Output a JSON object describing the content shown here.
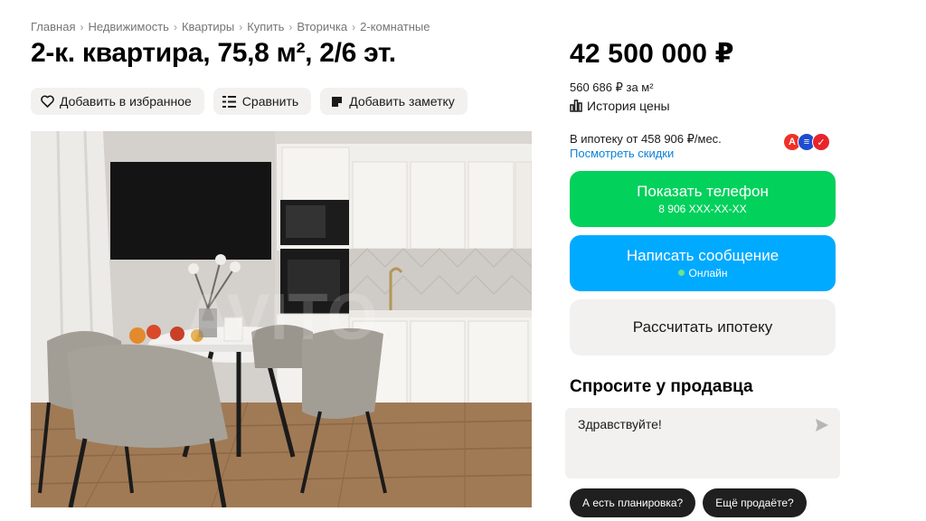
{
  "breadcrumbs": [
    "Главная",
    "Недвижимость",
    "Квартиры",
    "Купить",
    "Вторичка",
    "2-комнатные"
  ],
  "breadcrumb_separator": "›",
  "title": "2-к. квартира, 75,8 м², 2/6 эт.",
  "actions": {
    "favorite": "Добавить в избранное",
    "compare": "Сравнить",
    "note": "Добавить заметку"
  },
  "photo": {
    "description_icon": "listing-photo",
    "watermark": "AVITO"
  },
  "price": {
    "value": "42 500 000 ₽",
    "per_sqm": "560 686 ₽ за м²",
    "history_label": "История цены"
  },
  "mortgage": {
    "text": "В ипотеку от 458 906 ₽/мес.",
    "discount_link": "Посмотреть скидки",
    "banks": [
      {
        "letter": "А",
        "color": "#ef3124"
      },
      {
        "letter": "≡",
        "color": "#1f4ccf"
      },
      {
        "letter": "✓",
        "color": "#e8232b"
      }
    ]
  },
  "buttons": {
    "phone_label": "Показать телефон",
    "phone_number": "8 906 XXX-XX-XX",
    "message_label": "Написать сообщение",
    "online_status": "Онлайн",
    "mortgage_calc": "Рассчитать ипотеку"
  },
  "ask_seller": {
    "title": "Спросите у продавца",
    "input_value": "Здравствуйте!",
    "chips": [
      "А есть планировка?",
      "Ещё продаёте?"
    ]
  },
  "colors": {
    "green": "#02d15c",
    "blue": "#00aaff",
    "link": "#0a83d6",
    "light_bg": "#f2f1f0"
  }
}
